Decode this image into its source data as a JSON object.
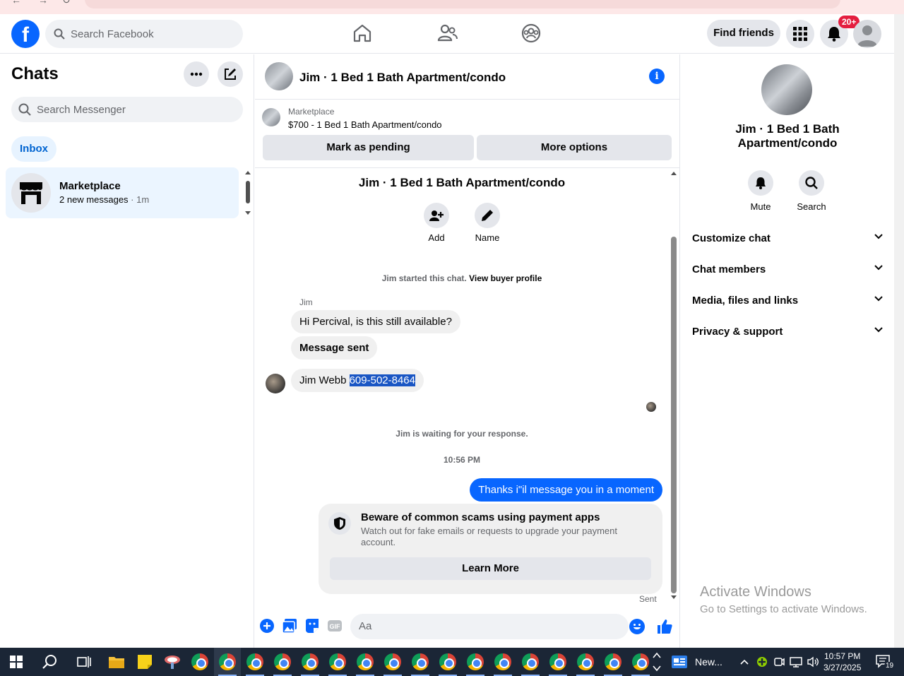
{
  "browser": {
    "url_fragment": "facebook.com/messages/t/290..."
  },
  "topbar": {
    "search_placeholder": "Search Facebook",
    "find_friends": "Find friends",
    "notification_badge": "20+"
  },
  "left": {
    "title": "Chats",
    "search_placeholder": "Search Messenger",
    "inbox_label": "Inbox",
    "chat_item": {
      "name": "Marketplace",
      "preview": "2 new messages",
      "sep": " · ",
      "time": "1m"
    }
  },
  "conversation": {
    "header_title": "Jim · 1 Bed 1 Bath Apartment/condo",
    "marketplace_label": "Marketplace",
    "listing": "$700 - 1 Bed 1 Bath Apartment/condo",
    "mark_pending": "Mark as pending",
    "more_options": "More options",
    "center_name": "Jim · 1 Bed 1 Bath Apartment/condo",
    "add_label": "Add",
    "name_label": "Name",
    "started_text": "Jim started this chat.",
    "buyer_profile": "View buyer profile",
    "sender": "Jim",
    "msg1": "Hi Percival, is this still available?",
    "msg2": "Message sent",
    "msg3_name": "Jim Webb ",
    "msg3_phone": "609-502-8464",
    "waiting": "Jim is waiting for your response.",
    "timestamp": "10:56 PM",
    "outgoing": "Thanks i\"il message you in a moment",
    "scam_title": "Beware of common scams using payment apps",
    "scam_desc": "Watch out for fake emails or requests to upgrade your payment account.",
    "learn_more": "Learn More",
    "sent": "Sent",
    "composer_placeholder": "Aa"
  },
  "right": {
    "name": "Jim · 1 Bed 1 Bath Apartment/condo",
    "mute": "Mute",
    "search": "Search",
    "sections": [
      "Customize chat",
      "Chat members",
      "Media, files and links",
      "Privacy & support"
    ],
    "activate_title": "Activate Windows",
    "activate_sub": "Go to Settings to activate Windows."
  },
  "taskbar": {
    "news": "New...",
    "time": "10:57 PM",
    "date": "3/27/2025",
    "notif_count": "19"
  },
  "colors": {
    "brand": "#0866ff",
    "bubble_in": "#f0f0f0",
    "highlight": "#1a56c4",
    "taskbar": "#1b2636"
  }
}
